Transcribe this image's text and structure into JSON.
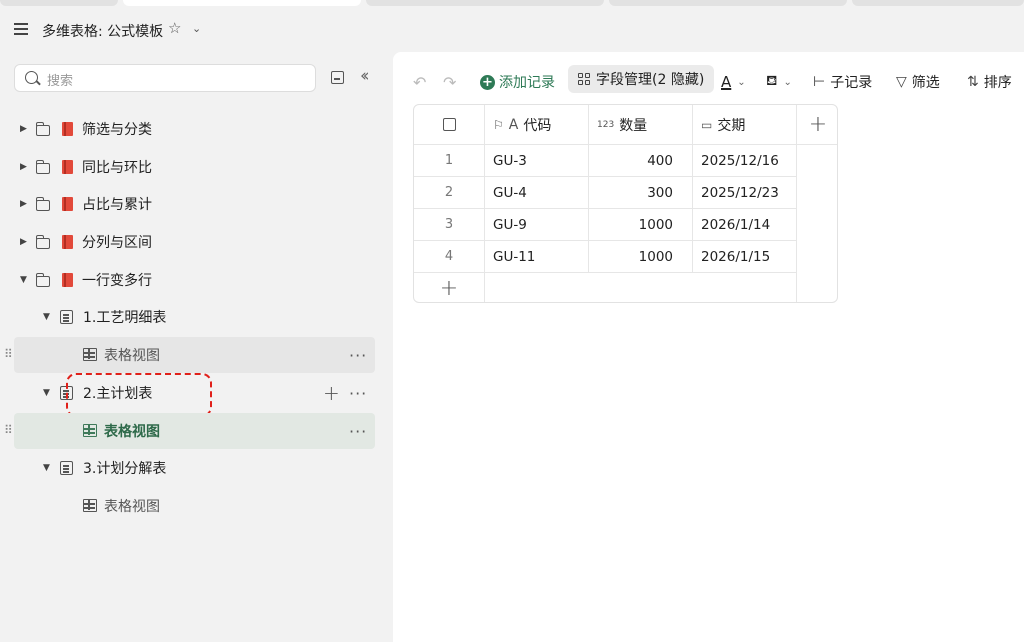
{
  "app": {
    "title": "多维表格: 公式模板"
  },
  "sidebar": {
    "search_placeholder": "搜索",
    "folders": [
      {
        "label": "筛选与分类"
      },
      {
        "label": "同比与环比"
      },
      {
        "label": "占比与累计"
      },
      {
        "label": "分列与区间"
      },
      {
        "label": "一行变多行"
      }
    ],
    "tables": [
      {
        "label": "1.工艺明细表",
        "view": "表格视图"
      },
      {
        "label": "2.主计划表",
        "view": "表格视图"
      },
      {
        "label": "3.计划分解表",
        "view": "表格视图"
      }
    ]
  },
  "toolbar": {
    "add_record": "添加记录",
    "field_manage": "字段管理(2 隐藏)",
    "font_color_glyph": "A",
    "sub_record": "子记录",
    "filter": "筛选",
    "sort": "排序"
  },
  "table": {
    "columns": [
      {
        "label": "代码",
        "icon": "A"
      },
      {
        "label": "数量",
        "icon": "123"
      },
      {
        "label": "交期",
        "icon": "calendar"
      }
    ],
    "rows": [
      {
        "index": "1",
        "code": "GU-3",
        "qty": "400",
        "due": "2025/12/16"
      },
      {
        "index": "2",
        "code": "GU-4",
        "qty": "300",
        "due": "2025/12/23"
      },
      {
        "index": "3",
        "code": "GU-9",
        "qty": "1000",
        "due": "2026/1/14"
      },
      {
        "index": "4",
        "code": "GU-11",
        "qty": "1000",
        "due": "2026/1/15"
      }
    ]
  }
}
